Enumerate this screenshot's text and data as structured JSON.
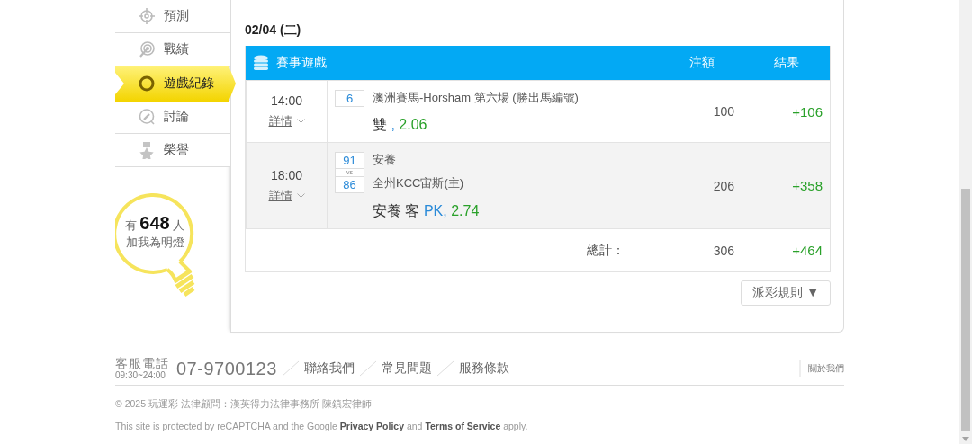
{
  "sidebar": {
    "items": [
      {
        "label": "預測",
        "selected": false
      },
      {
        "label": "戰績",
        "selected": false
      },
      {
        "label": "遊戲紀錄",
        "selected": true
      },
      {
        "label": "討論",
        "selected": false
      },
      {
        "label": "榮譽",
        "selected": false
      }
    ],
    "fans": {
      "prefix": "有",
      "count": "648",
      "suffix": "人",
      "caption": "加我為明燈"
    }
  },
  "record": {
    "date": "02/04 (二)",
    "table": {
      "title": "賽事遊戲",
      "columns": [
        "注額",
        "結果"
      ],
      "rows": [
        {
          "time": "14:00",
          "details": "詳情",
          "numbers": [
            "6"
          ],
          "lines": [
            "澳洲賽馬-Horsham 第六場 (勝出馬編號)"
          ],
          "pick": [
            {
              "text": "雙",
              "kind": "selection"
            },
            {
              "text": ",",
              "kind": "handicap"
            },
            {
              "text": "2.06",
              "kind": "odds"
            }
          ],
          "stake": "100",
          "result": "+106"
        },
        {
          "time": "18:00",
          "details": "詳情",
          "numbers": [
            "91",
            "86"
          ],
          "vs": "vs",
          "lines": [
            "安養",
            "全州KCC宙斯(主)"
          ],
          "pick": [
            {
              "text": "安養 客",
              "kind": "selection"
            },
            {
              "text": "PK,",
              "kind": "handicap"
            },
            {
              "text": "2.74",
              "kind": "odds"
            }
          ],
          "stake": "206",
          "result": "+358"
        }
      ],
      "total": {
        "label": "總計：",
        "stake": "306",
        "result": "+464"
      }
    },
    "rules_button": {
      "label": "派彩規則",
      "caret": "▼"
    }
  },
  "footer": {
    "phone_label": "客服電話",
    "hours": "09:30~24:00",
    "phone": "07-9700123",
    "links": [
      "聯絡我們",
      "常見問題",
      "服務條款"
    ],
    "about": "關於我們",
    "copyright": "© 2025 玩運彩 法律顧問：漢英得力法律事務所 陳鎮宏律師",
    "recaptcha": "This site is protected by reCAPTCHA and the Google **Privacy Policy** and **Terms of Service** apply."
  }
}
